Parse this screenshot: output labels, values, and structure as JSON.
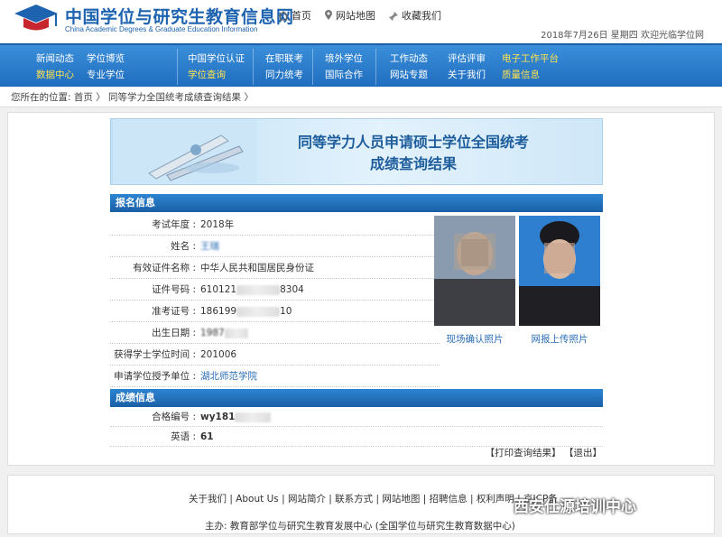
{
  "header": {
    "title": "中国学位与研究生教育信息网",
    "subtitle": "China Academic Degrees & Graduate Education Information",
    "toplinks": [
      {
        "icon": "home-icon",
        "label": "首页"
      },
      {
        "icon": "map-pin-icon",
        "label": "网站地图"
      },
      {
        "icon": "bookmark-icon",
        "label": "收藏我们"
      }
    ],
    "date_text": "2018年7月26日  星期四  欢迎光临学位网"
  },
  "nav": {
    "col1": [
      "新闻动态",
      "数据中心"
    ],
    "col2": [
      "学位博览",
      "专业学位"
    ],
    "col3": [
      "中国学位认证",
      "学位查询"
    ],
    "col4": [
      "在职联考",
      "同力统考"
    ],
    "col5": [
      "境外学位",
      "国际合作"
    ],
    "col6": [
      "工作动态",
      "网站专题"
    ],
    "col7": [
      "评估评审",
      "关于我们"
    ],
    "col8": [
      "电子工作平台",
      "质量信息"
    ]
  },
  "breadcrumb": {
    "text": "您所在的位置:  首页  〉 同等学力全国统考成绩查询结果  〉"
  },
  "banner": {
    "line1": "同等学力人员申请硕士学位全国统考",
    "line2": "成绩查询结果"
  },
  "registration": {
    "heading": "报名信息",
    "rows": [
      {
        "label": "考试年度",
        "value": "2018年"
      },
      {
        "label": "姓名",
        "value": "王瑞"
      },
      {
        "label": "有效证件名称",
        "value": "中华人民共和国居民身份证"
      },
      {
        "label": "证件号码",
        "value": "610121",
        "suffix": "8304"
      },
      {
        "label": "准考证号",
        "value": "186199",
        "suffix": "10"
      },
      {
        "label": "出生日期",
        "value": "1987"
      },
      {
        "label": "获得学士学位时间",
        "value": "201006"
      },
      {
        "label": "申请学位授予单位",
        "value": "湖北师范学院"
      }
    ],
    "photo_onsite": "现场确认照片",
    "photo_upload": "网报上传照片"
  },
  "score": {
    "heading": "成绩信息",
    "rows": [
      {
        "label": "合格编号",
        "value": "wy181"
      },
      {
        "label": "英语",
        "value": "61"
      }
    ]
  },
  "actions": {
    "print": "【打印查询结果】",
    "exit": "【退出】"
  },
  "footer": {
    "links": "关于我们 | About Us | 网站简介 | 联系方式 | 网站地图 | 招聘信息 | 权利声明 | 京ICP备",
    "host": "主办: 教育部学位与研究生教育发展中心 (全国学位与研究生教育数据中心)",
    "watermark": "西安仕源培训中心"
  }
}
